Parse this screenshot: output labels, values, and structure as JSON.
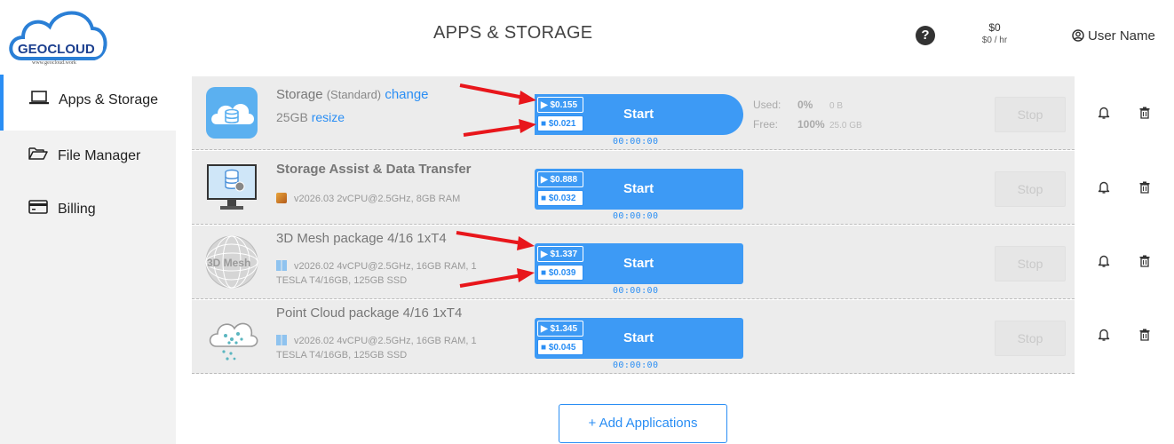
{
  "header": {
    "logo_text": "GEOCLOUD",
    "logo_url_text": "www.geocloud.work",
    "title": "APPS & STORAGE",
    "cost_total": "$0",
    "cost_rate": "$0 / hr",
    "user_name": "User Name"
  },
  "sidebar": {
    "items": [
      {
        "label": "Apps & Storage",
        "icon": "laptop-icon",
        "active": true
      },
      {
        "label": "File Manager",
        "icon": "folder-open-icon",
        "active": false
      },
      {
        "label": "Billing",
        "icon": "credit-card-icon",
        "active": false
      }
    ]
  },
  "apps": [
    {
      "title": "Storage",
      "title_suffix": "(Standard)",
      "change_label": "change",
      "size": "25GB",
      "resize_label": "resize",
      "run_price": "▶ $0.155",
      "stop_price": "■ $0.021",
      "start_label": "Start",
      "timer": "00:00:00",
      "used_label": "Used:",
      "used_pct": "0%",
      "used_size": "0 B",
      "free_label": "Free:",
      "free_pct": "100%",
      "free_size": "25.0 GB",
      "stop_label": "Stop"
    },
    {
      "title": "Storage Assist & Data Transfer",
      "spec_line1": "v2026.03  2vCPU@2.5GHz, 8GB RAM",
      "spec_line2": "",
      "run_price": "▶ $0.888",
      "stop_price": "■ $0.032",
      "start_label": "Start",
      "timer": "00:00:00",
      "stop_label": "Stop"
    },
    {
      "title": "3D Mesh package 4/16 1xT4",
      "icon_text": "3D Mesh",
      "spec_line1": "v2026.02  4vCPU@2.5GHz, 16GB RAM, 1",
      "spec_line2": "TESLA T4/16GB, 125GB SSD",
      "run_price": "▶ $1.337",
      "stop_price": "■ $0.039",
      "start_label": "Start",
      "timer": "00:00:00",
      "stop_label": "Stop"
    },
    {
      "title": "Point Cloud package 4/16 1xT4",
      "spec_line1": "v2026.02  4vCPU@2.5GHz, 16GB RAM, 1",
      "spec_line2": "TESLA T4/16GB, 125GB SSD",
      "run_price": "▶ $1.345",
      "stop_price": "■ $0.045",
      "start_label": "Start",
      "timer": "00:00:00",
      "stop_label": "Stop"
    }
  ],
  "add_button_label": "+ Add Applications",
  "colors": {
    "accent": "#3d9af5",
    "active_border": "#2a8ef4",
    "annotation_arrow": "#e8161b"
  }
}
